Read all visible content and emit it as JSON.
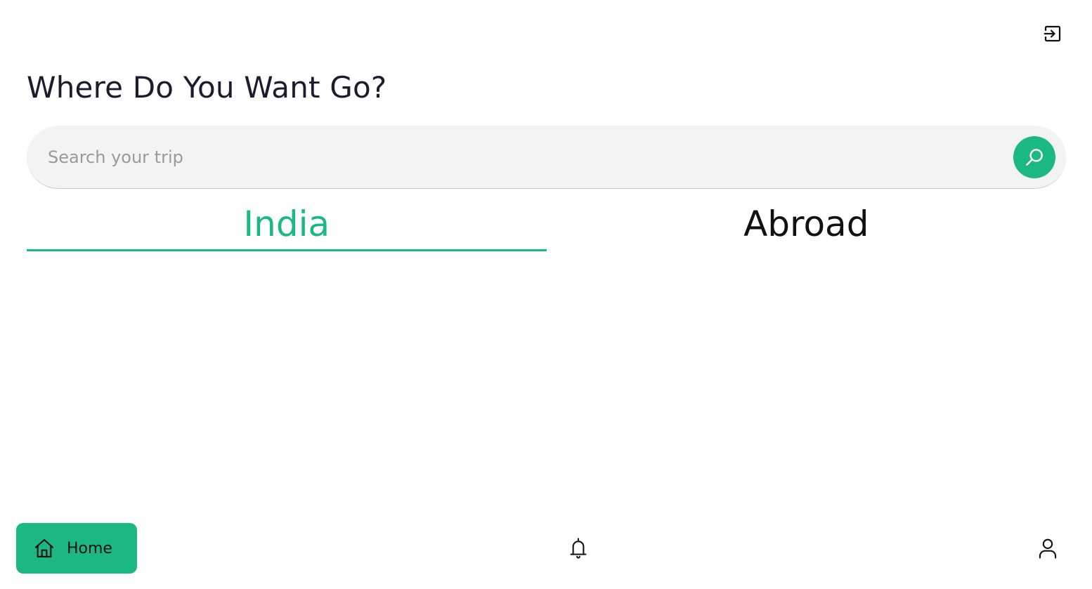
{
  "header": {
    "logout_icon": "logout-icon",
    "title": "Where Do You Want Go?"
  },
  "search": {
    "placeholder": "Search your trip",
    "value": "",
    "button_icon": "search-icon"
  },
  "tabs": [
    {
      "label": "India",
      "active": true
    },
    {
      "label": "Abroad",
      "active": false
    }
  ],
  "bottom_nav": {
    "home": {
      "label": "Home",
      "icon": "home-icon",
      "active": true
    },
    "notifications": {
      "icon": "bell-icon"
    },
    "profile": {
      "icon": "user-icon"
    }
  },
  "colors": {
    "accent": "#1cb884",
    "search_bg": "#f3f3f3",
    "title": "#1c1c2e",
    "tab_inactive": "#111111",
    "placeholder": "#9a9a9a"
  }
}
